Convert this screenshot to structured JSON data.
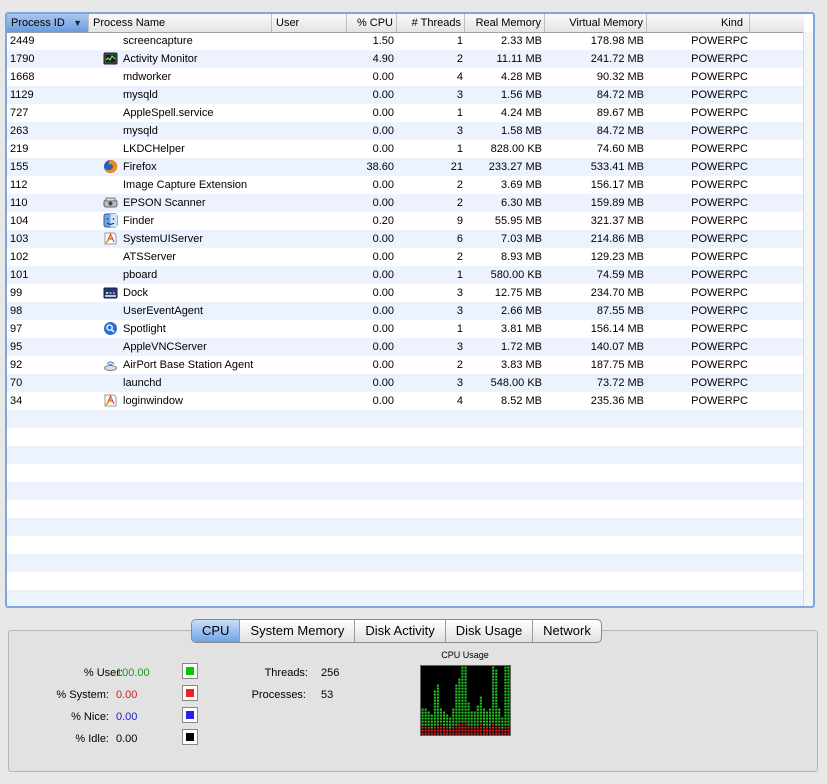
{
  "table": {
    "columns": [
      {
        "key": "pid",
        "label": "Process ID",
        "sorted": true,
        "sort_indicator": "▼"
      },
      {
        "key": "name",
        "label": "Process Name"
      },
      {
        "key": "user",
        "label": "User"
      },
      {
        "key": "cpu",
        "label": "% CPU"
      },
      {
        "key": "threads",
        "label": "# Threads"
      },
      {
        "key": "real_mem",
        "label": "Real Memory"
      },
      {
        "key": "virt_mem",
        "label": "Virtual Memory"
      },
      {
        "key": "kind",
        "label": "Kind"
      }
    ],
    "rows": [
      {
        "pid": "2449",
        "name": "screencapture",
        "icon": "",
        "user": "",
        "cpu": "1.50",
        "threads": "1",
        "real_mem": "2.33 MB",
        "virt_mem": "178.98 MB",
        "kind": "POWERPC"
      },
      {
        "pid": "1790",
        "name": "Activity Monitor",
        "icon": "activity-monitor-icon",
        "user": "",
        "cpu": "4.90",
        "threads": "2",
        "real_mem": "11.11 MB",
        "virt_mem": "241.72 MB",
        "kind": "POWERPC"
      },
      {
        "pid": "1668",
        "name": "mdworker",
        "icon": "",
        "user": "",
        "cpu": "0.00",
        "threads": "4",
        "real_mem": "4.28 MB",
        "virt_mem": "90.32 MB",
        "kind": "POWERPC"
      },
      {
        "pid": "1129",
        "name": "mysqld",
        "icon": "",
        "user": "",
        "cpu": "0.00",
        "threads": "3",
        "real_mem": "1.56 MB",
        "virt_mem": "84.72 MB",
        "kind": "POWERPC"
      },
      {
        "pid": "727",
        "name": "AppleSpell.service",
        "icon": "",
        "user": "",
        "cpu": "0.00",
        "threads": "1",
        "real_mem": "4.24 MB",
        "virt_mem": "89.67 MB",
        "kind": "POWERPC"
      },
      {
        "pid": "263",
        "name": "mysqld",
        "icon": "",
        "user": "",
        "cpu": "0.00",
        "threads": "3",
        "real_mem": "1.58 MB",
        "virt_mem": "84.72 MB",
        "kind": "POWERPC"
      },
      {
        "pid": "219",
        "name": "LKDCHelper",
        "icon": "",
        "user": "",
        "cpu": "0.00",
        "threads": "1",
        "real_mem": "828.00 KB",
        "virt_mem": "74.60 MB",
        "kind": "POWERPC"
      },
      {
        "pid": "155",
        "name": "Firefox",
        "icon": "firefox-icon",
        "user": "",
        "cpu": "38.60",
        "threads": "21",
        "real_mem": "233.27 MB",
        "virt_mem": "533.41 MB",
        "kind": "POWERPC"
      },
      {
        "pid": "112",
        "name": "Image Capture Extension",
        "icon": "",
        "user": "",
        "cpu": "0.00",
        "threads": "2",
        "real_mem": "3.69 MB",
        "virt_mem": "156.17 MB",
        "kind": "POWERPC"
      },
      {
        "pid": "110",
        "name": "EPSON Scanner",
        "icon": "scanner-icon",
        "user": "",
        "cpu": "0.00",
        "threads": "2",
        "real_mem": "6.30 MB",
        "virt_mem": "159.89 MB",
        "kind": "POWERPC"
      },
      {
        "pid": "104",
        "name": "Finder",
        "icon": "finder-icon",
        "user": "",
        "cpu": "0.20",
        "threads": "9",
        "real_mem": "55.95 MB",
        "virt_mem": "321.37 MB",
        "kind": "POWERPC"
      },
      {
        "pid": "103",
        "name": "SystemUIServer",
        "icon": "application-icon",
        "user": "",
        "cpu": "0.00",
        "threads": "6",
        "real_mem": "7.03 MB",
        "virt_mem": "214.86 MB",
        "kind": "POWERPC"
      },
      {
        "pid": "102",
        "name": "ATSServer",
        "icon": "",
        "user": "",
        "cpu": "0.00",
        "threads": "2",
        "real_mem": "8.93 MB",
        "virt_mem": "129.23 MB",
        "kind": "POWERPC"
      },
      {
        "pid": "101",
        "name": "pboard",
        "icon": "",
        "user": "",
        "cpu": "0.00",
        "threads": "1",
        "real_mem": "580.00 KB",
        "virt_mem": "74.59 MB",
        "kind": "POWERPC"
      },
      {
        "pid": "99",
        "name": "Dock",
        "icon": "dock-icon",
        "user": "",
        "cpu": "0.00",
        "threads": "3",
        "real_mem": "12.75 MB",
        "virt_mem": "234.70 MB",
        "kind": "POWERPC"
      },
      {
        "pid": "98",
        "name": "UserEventAgent",
        "icon": "",
        "user": "",
        "cpu": "0.00",
        "threads": "3",
        "real_mem": "2.66 MB",
        "virt_mem": "87.55 MB",
        "kind": "POWERPC"
      },
      {
        "pid": "97",
        "name": "Spotlight",
        "icon": "spotlight-icon",
        "user": "",
        "cpu": "0.00",
        "threads": "1",
        "real_mem": "3.81 MB",
        "virt_mem": "156.14 MB",
        "kind": "POWERPC"
      },
      {
        "pid": "95",
        "name": "AppleVNCServer",
        "icon": "",
        "user": "",
        "cpu": "0.00",
        "threads": "3",
        "real_mem": "1.72 MB",
        "virt_mem": "140.07 MB",
        "kind": "POWERPC"
      },
      {
        "pid": "92",
        "name": "AirPort Base Station Agent",
        "icon": "airport-icon",
        "user": "",
        "cpu": "0.00",
        "threads": "2",
        "real_mem": "3.83 MB",
        "virt_mem": "187.75 MB",
        "kind": "POWERPC"
      },
      {
        "pid": "70",
        "name": "launchd",
        "icon": "",
        "user": "",
        "cpu": "0.00",
        "threads": "3",
        "real_mem": "548.00 KB",
        "virt_mem": "73.72 MB",
        "kind": "POWERPC"
      },
      {
        "pid": "34",
        "name": "loginwindow",
        "icon": "application-icon",
        "user": "",
        "cpu": "0.00",
        "threads": "4",
        "real_mem": "8.52 MB",
        "virt_mem": "235.36 MB",
        "kind": "POWERPC"
      }
    ]
  },
  "tabs": [
    {
      "label": "CPU",
      "active": true
    },
    {
      "label": "System Memory",
      "active": false
    },
    {
      "label": "Disk Activity",
      "active": false
    },
    {
      "label": "Disk Usage",
      "active": false
    },
    {
      "label": "Network",
      "active": false
    }
  ],
  "cpu_stats": {
    "user_label": "% User:",
    "user_value": "100.00",
    "user_color": "#00cc00",
    "system_label": "% System:",
    "system_value": "0.00",
    "system_color": "#ee2222",
    "nice_label": "% Nice:",
    "nice_value": "0.00",
    "nice_color": "#2222ee",
    "idle_label": "% Idle:",
    "idle_value": "0.00",
    "idle_color": "#000000",
    "threads_label": "Threads:",
    "threads_value": "256",
    "processes_label": "Processes:",
    "processes_value": "53"
  },
  "cpu_graph": {
    "title": "CPU Usage",
    "user_color": "#22cc22",
    "system_color": "#dd2222",
    "user_pct": [
      28,
      26,
      24,
      20,
      50,
      62,
      24,
      22,
      18,
      16,
      28,
      60,
      68,
      90,
      94,
      32,
      24,
      22,
      30,
      40,
      26,
      22,
      24,
      94,
      80,
      26,
      18,
      92,
      96
    ],
    "system_pct": [
      10,
      12,
      10,
      8,
      12,
      10,
      14,
      10,
      10,
      8,
      10,
      12,
      14,
      16,
      14,
      12,
      10,
      10,
      12,
      14,
      10,
      10,
      12,
      14,
      12,
      10,
      8,
      12,
      10
    ]
  }
}
